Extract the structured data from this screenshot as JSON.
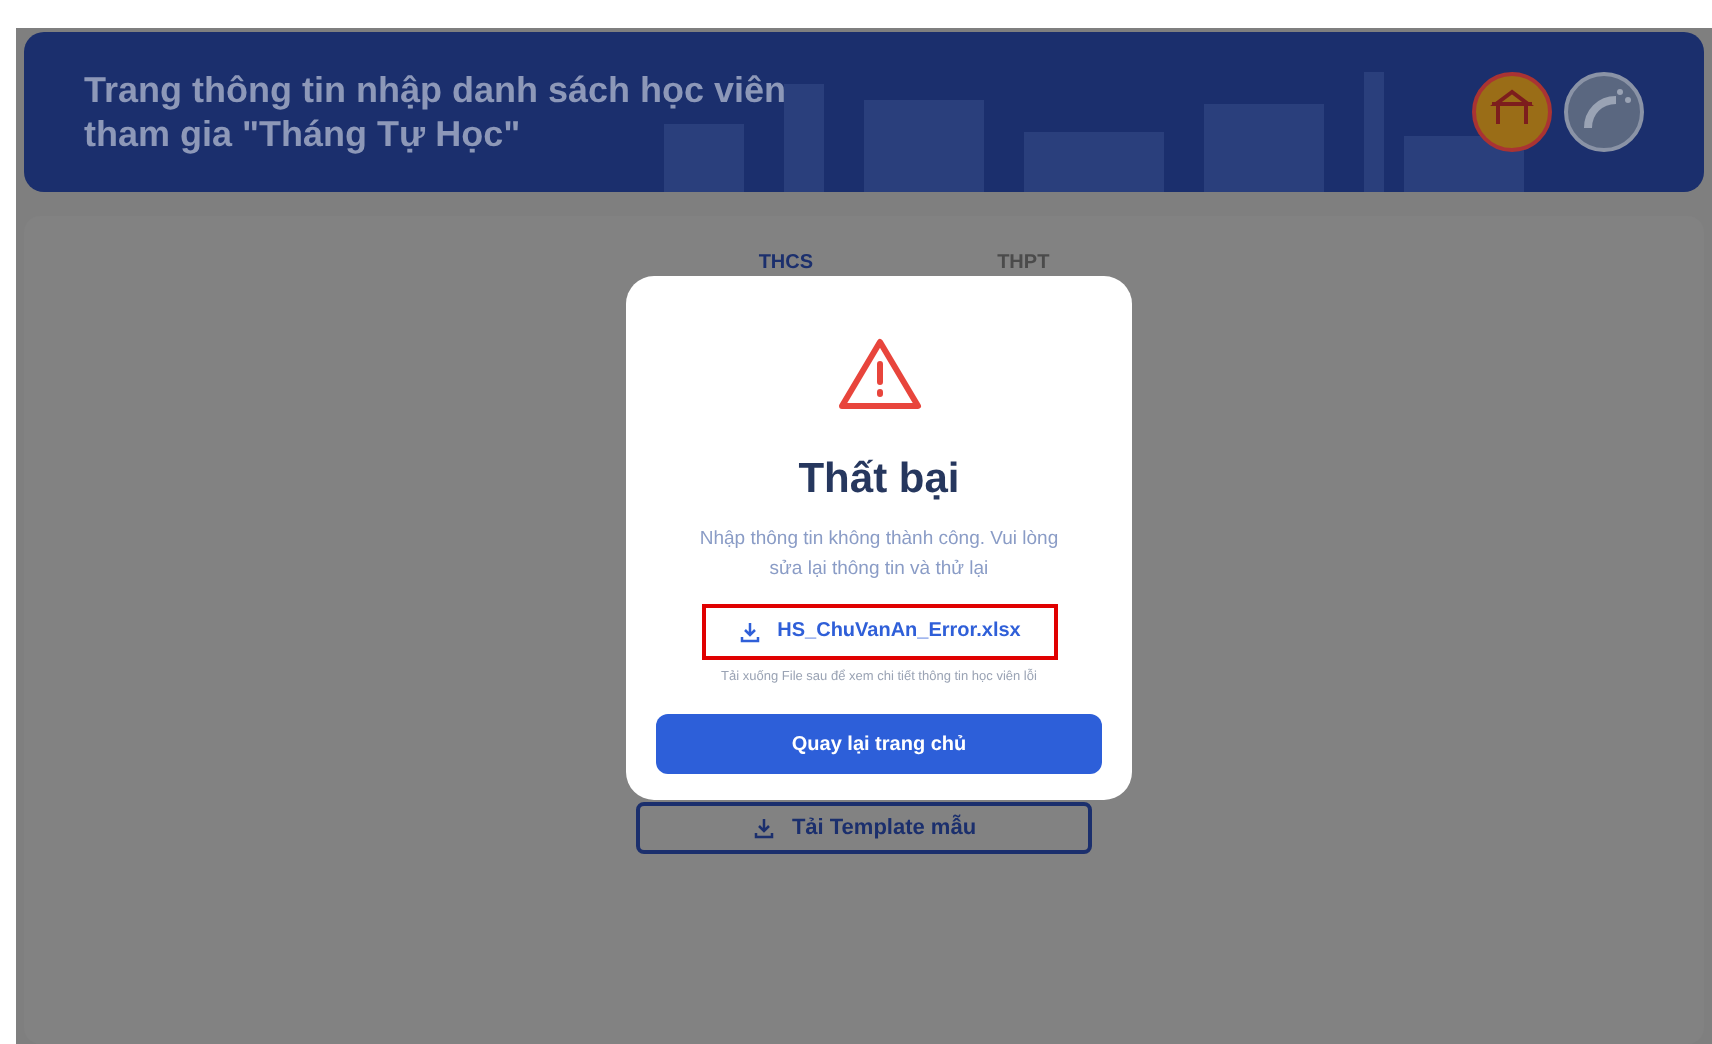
{
  "header": {
    "title_lines": [
      "Trang thông tin nhập danh sách học viên",
      "tham gia \"Tháng Tự Học\""
    ]
  },
  "tabs": [
    {
      "label": "THCS",
      "selected": true
    },
    {
      "label": "THPT",
      "selected": false
    }
  ],
  "template_button": {
    "label": "Tải Template mẫu"
  },
  "dialog": {
    "title": "Thất bại",
    "message_lines": [
      "Nhập thông tin không thành công. Vui lòng",
      "sửa lại thông tin và thử lại"
    ],
    "file_link": "HS_ChuVanAn_Error.xlsx",
    "hint": "Tải xuống File sau để xem chi tiết thông tin học viên lỗi",
    "button": "Quay lại trang chủ"
  }
}
